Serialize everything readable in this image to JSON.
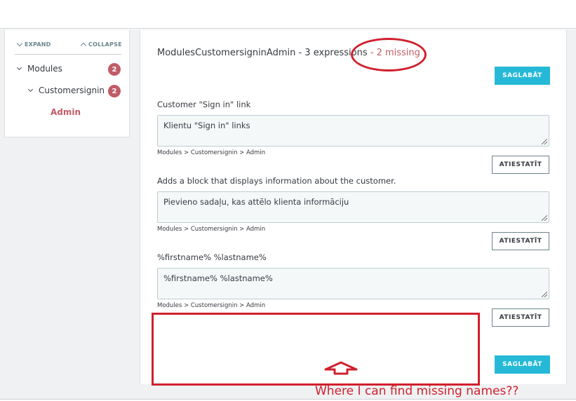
{
  "tree": {
    "expand_label": "EXPAND",
    "collapse_label": "COLLAPSE",
    "nodes": [
      {
        "label": "Modules",
        "count": "2"
      },
      {
        "label": "Customersignin",
        "count": "2"
      },
      {
        "label": "Admin"
      }
    ]
  },
  "header": {
    "title": "ModulesCustomersigninAdmin - 3 expressions",
    "missing": " - 2 missing"
  },
  "buttons": {
    "save_label": "SAGLABĀT",
    "reset_label": "ATIESTATĪT"
  },
  "expressions": [
    {
      "label": "Customer \"Sign in\" link",
      "value": "Klientu \"Sign in\" links",
      "path": "Modules > Customersignin > Admin"
    },
    {
      "label": "Adds a block that displays information about the customer.",
      "value": "Pievieno sadaļu, kas attēlo klienta informāciju",
      "path": "Modules > Customersignin > Admin"
    },
    {
      "label": "%firstname% %lastname%",
      "value": "%firstname% %lastname%",
      "path": "Modules > Customersignin > Admin"
    }
  ],
  "annotation": {
    "note": "Where I can find missing names??",
    "color": "#d0202e"
  },
  "colors": {
    "accent": "#25b9d7",
    "missing": "#c05c67"
  }
}
